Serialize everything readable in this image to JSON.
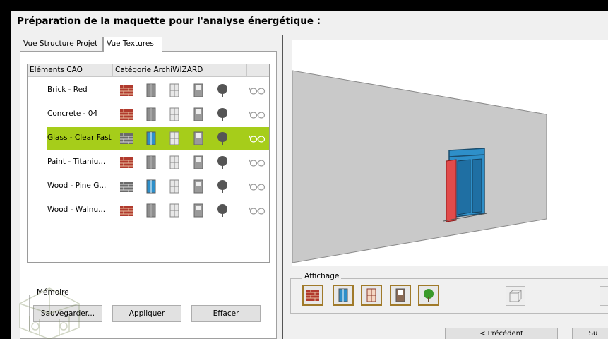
{
  "title": "Préparation de la maquette pour l'analyse énergétique :",
  "tabs": [
    {
      "label": "Vue Structure Projet",
      "active": false
    },
    {
      "label": "Vue Textures",
      "active": true
    }
  ],
  "tree": {
    "headers": [
      "Eléments CAO",
      "Catégorie ArchiWIZARD"
    ],
    "rows": [
      {
        "label": "Brick - Red",
        "selected": false,
        "active_window": false
      },
      {
        "label": "Concrete - 04",
        "selected": false,
        "active_window": false
      },
      {
        "label": "Glass - Clear Fast",
        "selected": true,
        "active_window": true
      },
      {
        "label": "Paint - Titaniu...",
        "selected": false,
        "active_window": false
      },
      {
        "label": "Wood - Pine G...",
        "selected": false,
        "active_window": true
      },
      {
        "label": "Wood - Walnu...",
        "selected": false,
        "active_window": false
      }
    ]
  },
  "memory": {
    "legend": "Mémoire",
    "buttons": {
      "save": "Sauvegarder...",
      "apply": "Appliquer",
      "clear": "Effacer"
    }
  },
  "display": {
    "legend": "Affichage"
  },
  "nav": {
    "prev": "< Précédent",
    "next": "Su"
  },
  "colors": {
    "selection": "#a6cd1a",
    "window_blue": "#2e8fc9",
    "brick_red": "#b13a2e",
    "frame_brown": "#a07a2a"
  },
  "icons": [
    "brick-icon",
    "window-icon",
    "door-icon",
    "door-icon",
    "tree-icon",
    "glasses-icon"
  ]
}
